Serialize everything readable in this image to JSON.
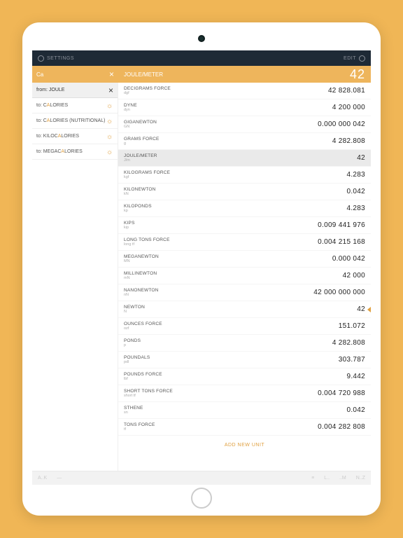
{
  "topbar": {
    "settings": "SETTINGS",
    "edit": "EDIT"
  },
  "subheader": {
    "search": "Ca",
    "unit_label": "JOULE/METER",
    "value": "42"
  },
  "sidebar": {
    "from_prefix": "from: ",
    "from_unit": "JOULE",
    "to_prefix": "to: ",
    "items": [
      {
        "pre": "C",
        "hl": "A",
        "post": "LORIES"
      },
      {
        "pre": "C",
        "hl": "A",
        "post": "LORIES (NUTRITIONAL)"
      },
      {
        "pre": "KILOC",
        "hl": "A",
        "post": "LORIES"
      },
      {
        "pre": "MEGAC",
        "hl": "A",
        "post": "LORIES"
      }
    ]
  },
  "units": [
    {
      "name": "DECIGRAMS FORCE",
      "abbr": "dgf",
      "value": "42 828.081"
    },
    {
      "name": "DYNE",
      "abbr": "dyn",
      "value": "4 200 000"
    },
    {
      "name": "GIGANEWTON",
      "abbr": "GN",
      "value": "0.000 000 042"
    },
    {
      "name": "GRAMS FORCE",
      "abbr": "g",
      "value": "4 282.808"
    },
    {
      "name": "JOULE/METER",
      "abbr": "J/m",
      "value": "42",
      "selected": true
    },
    {
      "name": "KILOGRAMS FORCE",
      "abbr": "kgf",
      "value": "4.283"
    },
    {
      "name": "KILONEWTON",
      "abbr": "kN",
      "value": "0.042"
    },
    {
      "name": "KILOPONDS",
      "abbr": "kp",
      "value": "4.283"
    },
    {
      "name": "KIPS",
      "abbr": "kip",
      "value": "0.009 441 976"
    },
    {
      "name": "LONG TONS FORCE",
      "abbr": "long tf",
      "value": "0.004 215 168"
    },
    {
      "name": "MEGANEWTON",
      "abbr": "MN",
      "value": "0.000 042"
    },
    {
      "name": "MILLINEWTON",
      "abbr": "mN",
      "value": "42 000"
    },
    {
      "name": "NANONEWTON",
      "abbr": "nN",
      "value": "42 000 000 000"
    },
    {
      "name": "NEWTON",
      "abbr": "N",
      "value": "42",
      "marker": true
    },
    {
      "name": "OUNCES FORCE",
      "abbr": "ozf",
      "value": "151.072"
    },
    {
      "name": "PONDS",
      "abbr": "p",
      "value": "4 282.808"
    },
    {
      "name": "POUNDALS",
      "abbr": "pdl",
      "value": "303.787"
    },
    {
      "name": "POUNDS FORCE",
      "abbr": "lbf",
      "value": "9.442"
    },
    {
      "name": "SHORT TONS FORCE",
      "abbr": "short tf",
      "value": "0.004 720 988"
    },
    {
      "name": "STHENE",
      "abbr": "sn",
      "value": "0.042"
    },
    {
      "name": "TONS FORCE",
      "abbr": "tf",
      "value": "0.004 282 808"
    }
  ],
  "add_unit": "ADD NEW UNIT",
  "bottombar": {
    "l1": "A..K",
    "l2": "—",
    "r1": "≡",
    "r2": "L..",
    "r3": "..M",
    "r4": "N..Z"
  }
}
